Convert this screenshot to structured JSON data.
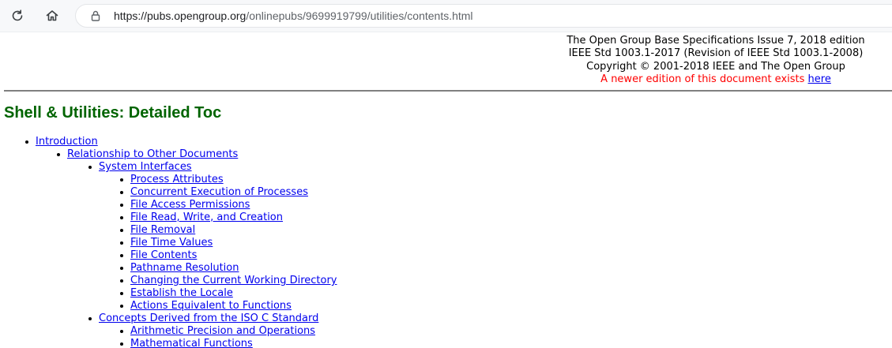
{
  "browser": {
    "url_host": "https://pubs.opengroup.org",
    "url_path": "/onlinepubs/9699919799/utilities/contents.html",
    "icons": [
      "reload-icon",
      "home-icon",
      "lock-icon"
    ]
  },
  "masthead": {
    "line1": "The Open Group Base Specifications Issue 7, 2018 edition",
    "line2": "IEEE Std 1003.1-2017 (Revision of IEEE Std 1003.1-2008)",
    "line3": "Copyright © 2001-2018 IEEE and The Open Group",
    "newer_text": "A newer edition of this document exists ",
    "newer_link": "here",
    "newer_color": "#ff0000"
  },
  "page": {
    "title": "Shell & Utilities: Detailed Toc",
    "title_color": "#006400",
    "link_color": "#0000ee"
  },
  "toc": [
    {
      "level": 1,
      "label": "Introduction"
    },
    {
      "level": 2,
      "label": "Relationship to Other Documents"
    },
    {
      "level": 3,
      "label": "System Interfaces"
    },
    {
      "level": 4,
      "label": "Process Attributes"
    },
    {
      "level": 4,
      "label": "Concurrent Execution of Processes"
    },
    {
      "level": 4,
      "label": "File Access Permissions"
    },
    {
      "level": 4,
      "label": "File Read, Write, and Creation"
    },
    {
      "level": 4,
      "label": "File Removal"
    },
    {
      "level": 4,
      "label": "File Time Values"
    },
    {
      "level": 4,
      "label": "File Contents"
    },
    {
      "level": 4,
      "label": "Pathname Resolution"
    },
    {
      "level": 4,
      "label": "Changing the Current Working Directory"
    },
    {
      "level": 4,
      "label": "Establish the Locale"
    },
    {
      "level": 4,
      "label": "Actions Equivalent to Functions"
    },
    {
      "level": 3,
      "label": "Concepts Derived from the ISO C Standard"
    },
    {
      "level": 4,
      "label": "Arithmetic Precision and Operations"
    },
    {
      "level": 4,
      "label": "Mathematical Functions"
    }
  ]
}
